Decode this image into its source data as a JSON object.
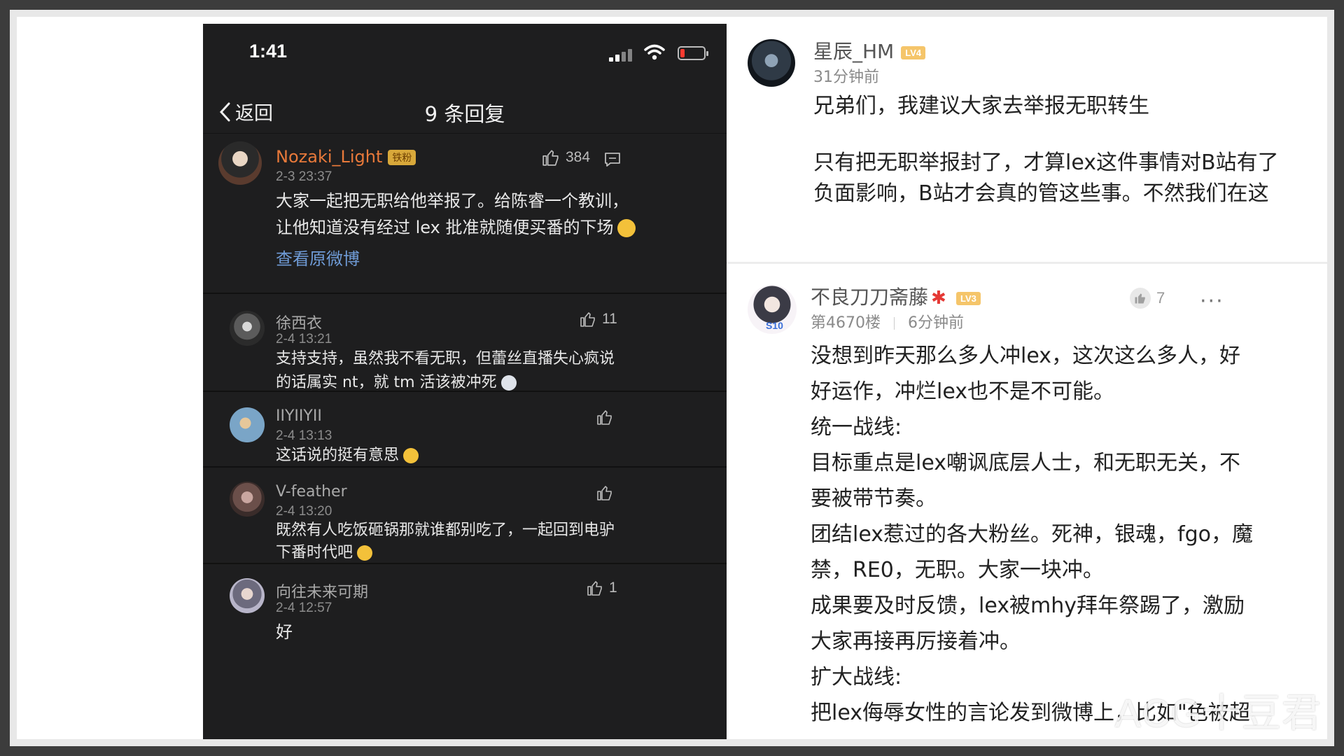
{
  "status_bar": {
    "time": "1:41"
  },
  "nav": {
    "back_label": "返回",
    "title": "9 条回复"
  },
  "main_comment": {
    "username": "Nozaki_Light",
    "badge": "铁粉",
    "timestamp": "2-3 23:37",
    "likes": "384",
    "lines": [
      "大家一起把无职给他举报了。给陈睿一个教训，",
      "让他知道没有经过 lex 批准就随便买番的下场"
    ],
    "view_original": "查看原微博",
    "username_color": "#e8793a"
  },
  "replies": [
    {
      "username": "徐西衣",
      "timestamp": "2-4 13:21",
      "likes": "11",
      "lines": [
        "支持支持，虽然我不看无职，但蕾丝直播失心疯说",
        "的话属实 nt，就 tm 活该被冲死"
      ]
    },
    {
      "username": "IIYIIYII",
      "timestamp": "2-4 13:13",
      "likes": "",
      "lines": [
        "这话说的挺有意思"
      ]
    },
    {
      "username": "V-feather",
      "timestamp": "2-4 13:20",
      "likes": "",
      "lines": [
        "既然有人吃饭砸锅那就谁都别吃了，一起回到电驴",
        "下番时代吧"
      ]
    },
    {
      "username": "向往未来可期",
      "timestamp": "2-4 12:57",
      "likes": "1",
      "lines": [
        "好"
      ]
    }
  ],
  "right_post_1": {
    "username": "星辰_HM",
    "level": "LV4",
    "time_ago": "31分钟前",
    "lines": [
      "兄弟们，我建议大家去举报无职转生",
      "",
      "只有把无职举报封了，才算lex这件事情对B站有了",
      "负面影响，B站才会真的管这些事。不然我们在这"
    ]
  },
  "right_post_2": {
    "username": "不良刀刀斋藤",
    "level": "LV3",
    "floor": "第4670楼",
    "time_ago": "6分钟前",
    "likes": "7",
    "avatar_tag": "S10",
    "lines": [
      "没想到昨天那么多人冲lex，这次这么多人，好",
      "好运作，冲烂lex也不是不可能。",
      "统一战线:",
      "目标重点是lex嘲讽底层人士，和无职无关，不",
      "要被带节奏。",
      "团结lex惹过的各大粉丝。死神，银魂，fgo，魔",
      "禁，RE0，无职。大家一块冲。",
      "成果要及时反馈，lex被mhy拜年祭踢了，激励",
      "大家再接再厉接着冲。",
      "扩大战线:",
      "把lex侮辱女性的言论发到微博上，比如\"色被超"
    ]
  },
  "watermark": "ACG十豆君",
  "colors": {
    "phone_bg": "#1e1e1f",
    "link": "#6f9bd6",
    "level_badge": "#f5c56a"
  }
}
